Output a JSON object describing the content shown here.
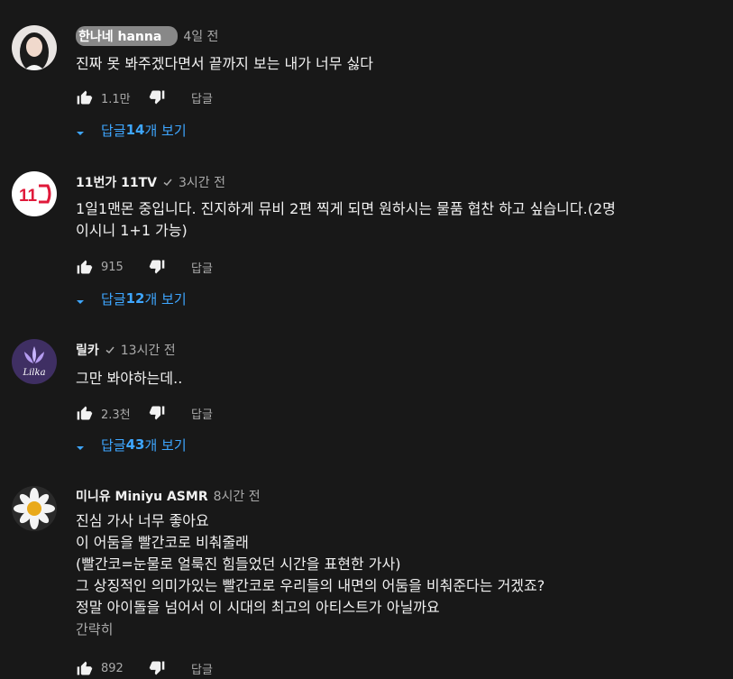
{
  "comments": [
    {
      "author": "한나네 hanna",
      "time": "4일 전",
      "lines": [
        "진짜 못 봐주겠다면서 끝까지 보는 내가 너무 싫다"
      ],
      "likes": "1.1만",
      "reply_label": "답글",
      "replies": {
        "prefix": "답글 ",
        "count": "14",
        "suffix": "개 보기"
      }
    },
    {
      "author": "11번가 11TV",
      "time": "3시간 전",
      "lines": [
        "1일1맨몬 중입니다. 진지하게 뮤비 2편 찍게 되면 원하시는 물품 협찬 하고 싶습니다.(2명",
        "이시니 1+1 가능)"
      ],
      "likes": "915",
      "reply_label": "답글",
      "replies": {
        "prefix": "답글 ",
        "count": "12",
        "suffix": "개 보기"
      }
    },
    {
      "author": "릴카",
      "time": "13시간 전",
      "lines": [
        "그만 봐야하는데.."
      ],
      "likes": "2.3천",
      "reply_label": "답글",
      "replies": {
        "prefix": "답글 ",
        "count": "43",
        "suffix": "개 보기"
      },
      "avatar_text": "Lilka"
    },
    {
      "author": "미니유 Miniyu ASMR",
      "time": "8시간 전",
      "lines": [
        "진심 가사 너무 좋아요",
        "이 어둠을 빨간코로 비춰줄래",
        "(빨간코=눈물로 얼룩진 힘들었던 시간을 표현한 가사)",
        "그 상징적인 의미가있는 빨간코로 우리들의 내면의 어둠을 비춰준다는 거겠죠?",
        "정말 아이돌을 넘어서 이 시대의 최고의 아티스트가 아닐까요"
      ],
      "read_more": "간략히",
      "likes": "892",
      "reply_label": "답글"
    }
  ],
  "icons": {
    "like": "thumbs-up-icon",
    "dislike": "thumbs-down-icon",
    "verified": "checkmark-icon",
    "expand": "caret-down-icon"
  },
  "colors": {
    "background": "#181818",
    "link": "#3ea6ff",
    "secondary_text": "#aaaaaa"
  }
}
